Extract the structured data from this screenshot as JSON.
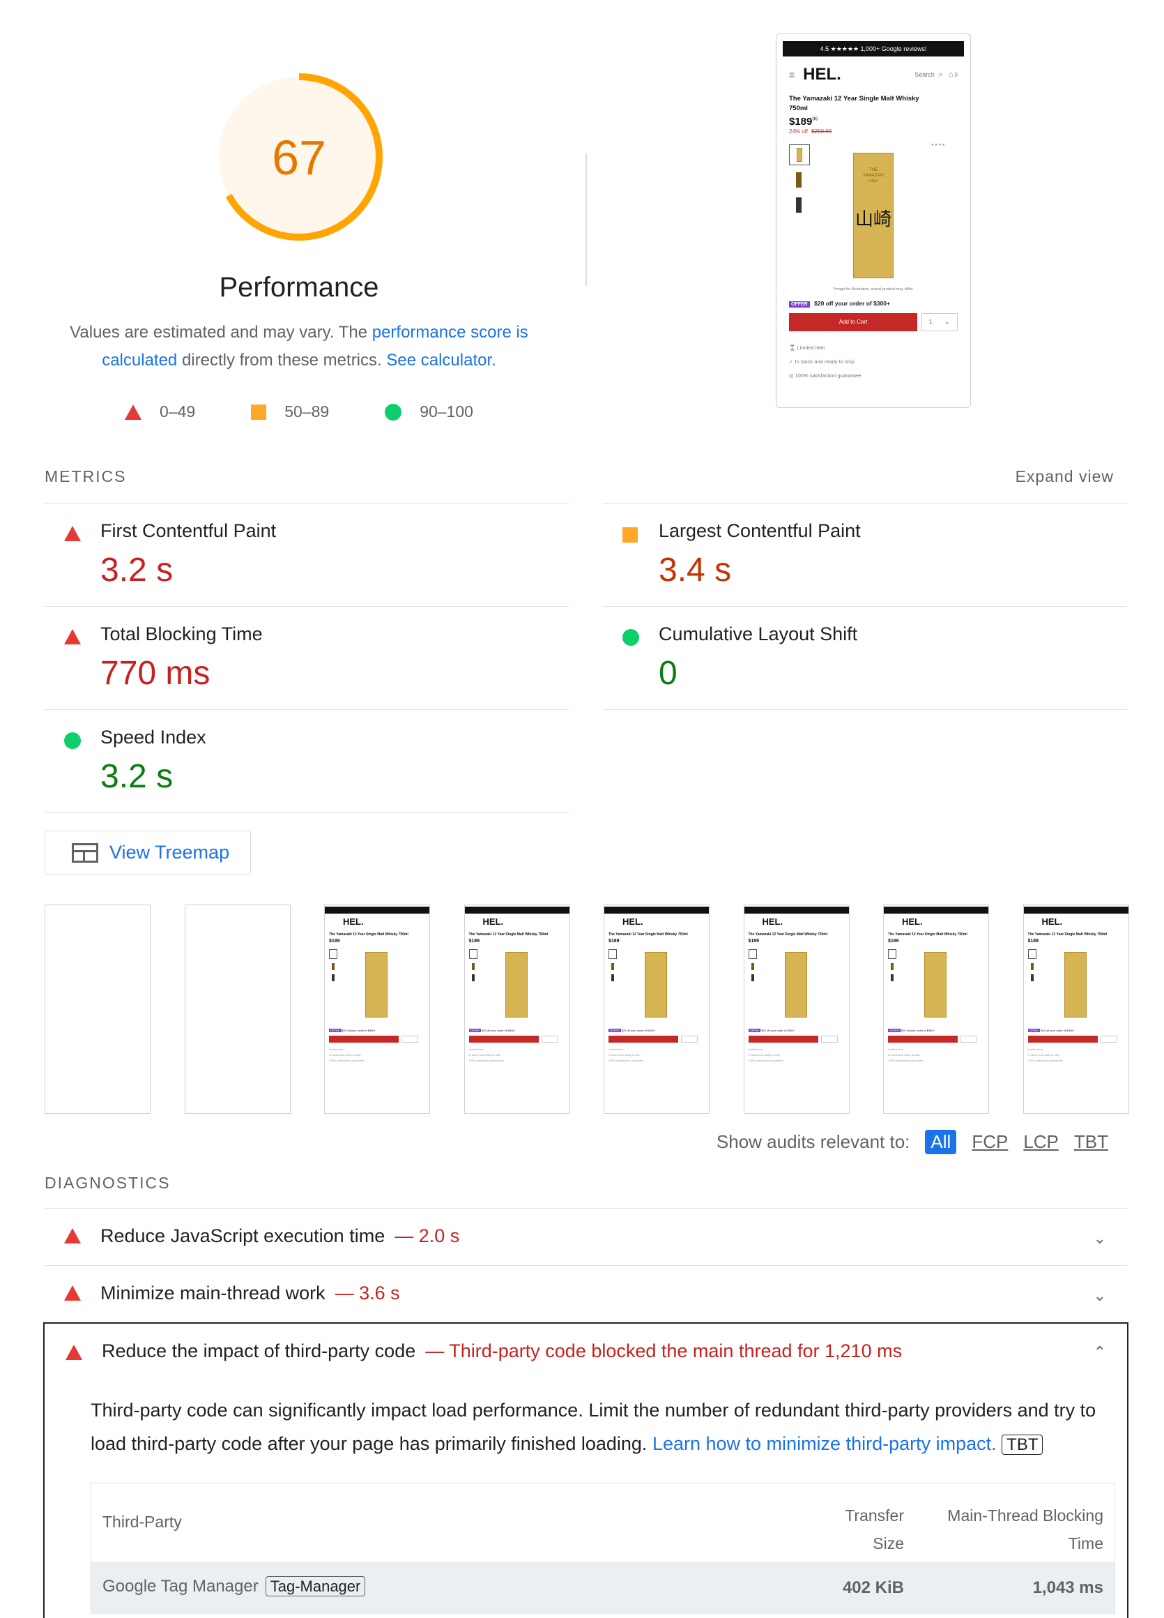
{
  "gauge": {
    "score": "67",
    "score_fraction": 0.67,
    "title": "Performance",
    "arc_color": "#ffa400",
    "fill_color": "#fff7ec"
  },
  "description": {
    "text_a": "Values are estimated and may vary. The ",
    "link_score": "performance score is calculated",
    "text_b": " directly from these metrics. ",
    "link_calc": "See calculator."
  },
  "legend": [
    {
      "icon": "triangle-icon",
      "label": "0–49"
    },
    {
      "icon": "square-icon",
      "label": "50–89"
    },
    {
      "icon": "circle-icon",
      "label": "90–100"
    }
  ],
  "screenshot": {
    "top_bar": "4.5 ★★★★★ 1,000+ Google reviews!",
    "logo": "HEL.",
    "search": "Search",
    "cart_count": "0",
    "product_title": "The Yamazaki 12 Year Single Malt Whisky 750ml",
    "price": "$189",
    "price_cents": "96",
    "discount": "24% off",
    "old_price": "$250.00",
    "image_note": "*Image for illustration, actual product may differ.",
    "offer_tag": "OFFER",
    "offer_text": "$20 off your order of $300+",
    "add_to_cart": "Add to Cart",
    "qty": "1",
    "info": [
      "Limited item",
      "In stock and ready to ship",
      "100% satisfaction guarantee"
    ]
  },
  "metrics": {
    "section_label": "METRICS",
    "expand_view": "Expand view",
    "items": [
      {
        "name": "First Contentful Paint",
        "value": "3.2 s",
        "rating": "fail"
      },
      {
        "name": "Largest Contentful Paint",
        "value": "3.4 s",
        "rating": "average"
      },
      {
        "name": "Total Blocking Time",
        "value": "770 ms",
        "rating": "fail"
      },
      {
        "name": "Cumulative Layout Shift",
        "value": "0",
        "rating": "pass"
      },
      {
        "name": "Speed Index",
        "value": "3.2 s",
        "rating": "pass"
      }
    ]
  },
  "treemap": {
    "label": "View Treemap"
  },
  "filmstrip": {
    "frames": 8,
    "blank_frames": 2
  },
  "filter": {
    "label": "Show audits relevant to:",
    "chips": [
      "All",
      "FCP",
      "LCP",
      "TBT"
    ],
    "active": "All"
  },
  "diagnostics": {
    "section_label": "DIAGNOSTICS",
    "items": [
      {
        "title": "Reduce JavaScript execution time",
        "display": "— 2.0 s"
      },
      {
        "title": "Minimize main-thread work",
        "display": "— 3.6 s"
      }
    ],
    "expanded": {
      "title": "Reduce the impact of third-party code",
      "display": "— Third-party code blocked the main thread for 1,210 ms",
      "desc_text": "Third-party code can significantly impact load performance. Limit the number of redundant third-party providers and try to load third-party code after your page has primarily finished loading. ",
      "desc_link": "Learn how to minimize third-party impact.",
      "tag": "TBT",
      "table": {
        "col1": "Third-Party",
        "col2_line1": "Transfer",
        "col2_line2": "Size",
        "col3_line1": "Main-Thread Blocking",
        "col3_line2": "Time",
        "rows": [
          {
            "name": "Google Tag Manager",
            "tag": "Tag-Manager",
            "size": "402 KiB",
            "time": "1,043 ms"
          }
        ]
      }
    }
  }
}
